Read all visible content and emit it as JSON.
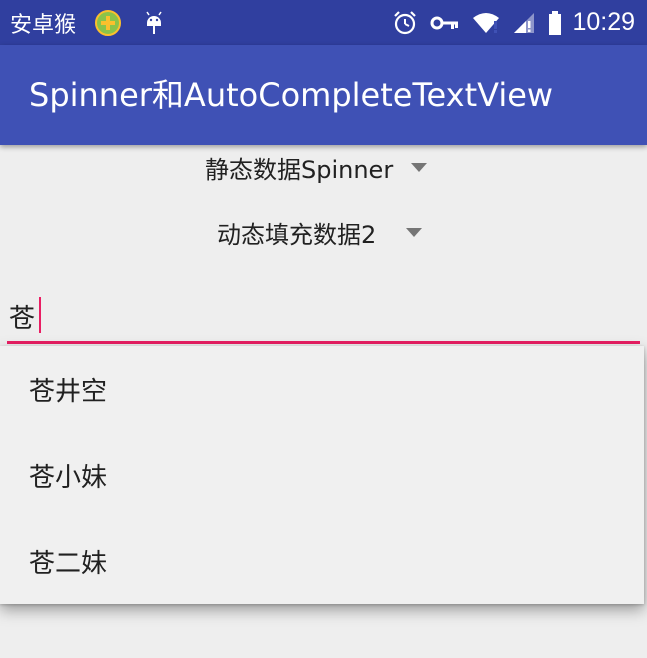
{
  "status_bar": {
    "carrier": "安卓猴",
    "time": "10:29",
    "icons": [
      "app-store-icon",
      "android-icon",
      "alarm-icon",
      "vpn-key-icon",
      "wifi-icon",
      "signal-icon",
      "battery-icon"
    ]
  },
  "app_bar": {
    "title": "Spinner和AutoCompleteTextView",
    "color": "#3f51b5"
  },
  "spinners": [
    {
      "selected": "静态数据Spinner"
    },
    {
      "selected": "动态填充数据2"
    }
  ],
  "autocomplete": {
    "value": "苍",
    "accent_color": "#e91e63"
  },
  "suggestions": [
    {
      "label": "苍井空"
    },
    {
      "label": "苍小妹"
    },
    {
      "label": "苍二妹"
    }
  ]
}
